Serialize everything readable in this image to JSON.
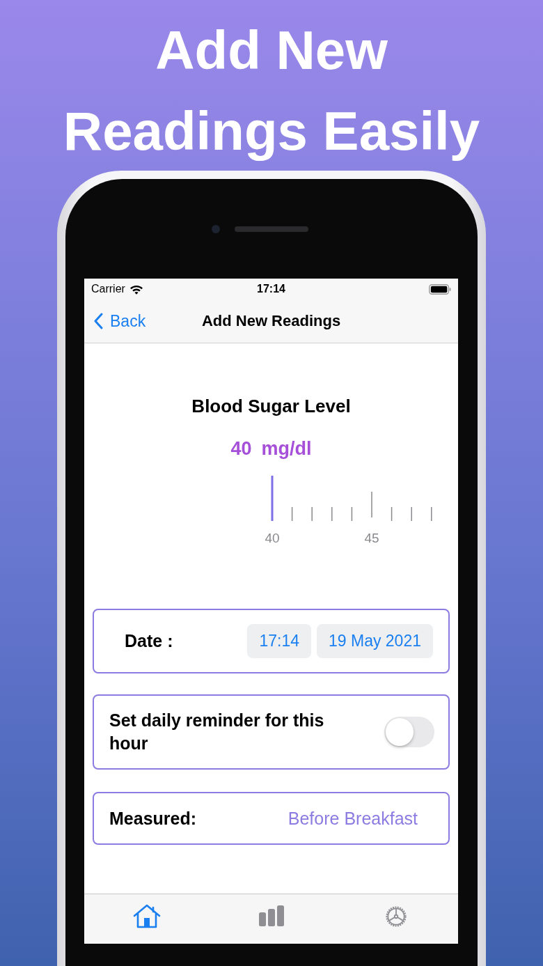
{
  "headline": [
    "Add New",
    "Readings Easily"
  ],
  "status_bar": {
    "carrier": "Carrier",
    "time": "17:14"
  },
  "nav": {
    "back": "Back",
    "title": "Add New Readings"
  },
  "reading": {
    "title": "Blood Sugar Level",
    "value": "40",
    "unit": "mg/dl",
    "ruler_labels": [
      "40",
      "45"
    ]
  },
  "date_card": {
    "label": "Date :",
    "time": "17:14",
    "date": "19 May 2021"
  },
  "reminder": {
    "label": "Set daily reminder for this hour",
    "on": false
  },
  "measured": {
    "label": "Measured:",
    "value": "Before Breakfast"
  },
  "tab_bar": [
    {
      "kind": "home",
      "selected": true
    },
    {
      "kind": "chart",
      "selected": false
    },
    {
      "kind": "settings",
      "selected": false
    }
  ]
}
